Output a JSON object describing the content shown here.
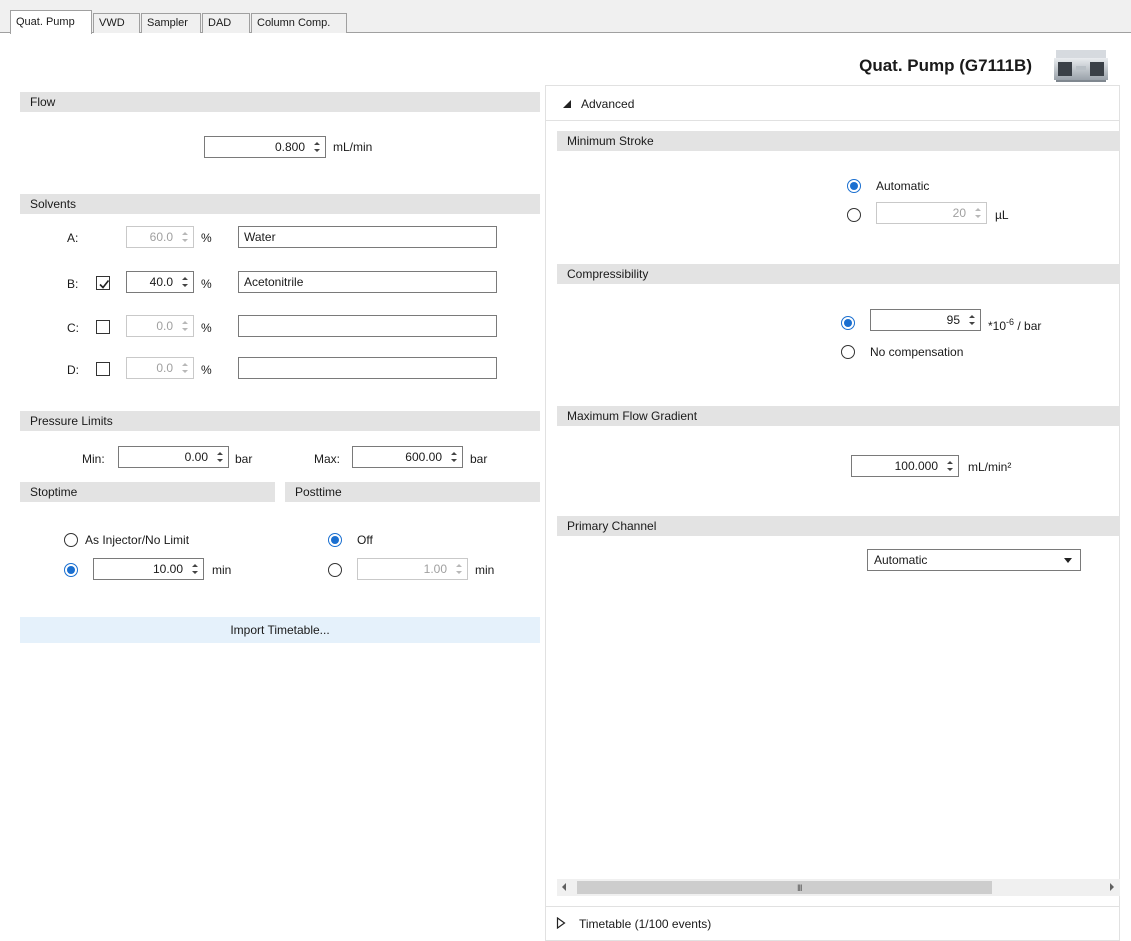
{
  "tabs": [
    {
      "label": "Quat. Pump"
    },
    {
      "label": "VWD"
    },
    {
      "label": "Sampler"
    },
    {
      "label": "DAD"
    },
    {
      "label": "Column Comp."
    }
  ],
  "module_title": "Quat. Pump (G7111B)",
  "flow": {
    "header": "Flow",
    "value": "0.800",
    "unit": "mL/min"
  },
  "solvents": {
    "header": "Solvents",
    "percent_sign": "%",
    "rows": [
      {
        "label": "A:",
        "percent": "60.0",
        "name": "Water",
        "has_checkbox": false
      },
      {
        "label": "B:",
        "percent": "40.0",
        "name": "Acetonitrile",
        "has_checkbox": true,
        "checked": true
      },
      {
        "label": "C:",
        "percent": "0.0",
        "name": "",
        "has_checkbox": true,
        "checked": false
      },
      {
        "label": "D:",
        "percent": "0.0",
        "name": "",
        "has_checkbox": true,
        "checked": false
      }
    ]
  },
  "pressure_limits": {
    "header": "Pressure Limits",
    "min_label": "Min:",
    "min_value": "0.00",
    "max_label": "Max:",
    "max_value": "600.00",
    "unit": "bar"
  },
  "stoptime": {
    "header": "Stoptime",
    "option_no_limit": "As Injector/No Limit",
    "value": "10.00",
    "unit": "min",
    "selected": "value"
  },
  "posttime": {
    "header": "Posttime",
    "option_off": "Off",
    "value": "1.00",
    "unit": "min",
    "selected": "off"
  },
  "import_button": "Import Timetable...",
  "advanced": {
    "label": "Advanced",
    "minimum_stroke": {
      "header": "Minimum Stroke",
      "option_auto": "Automatic",
      "value": "20",
      "unit": "µL",
      "selected": "auto"
    },
    "compressibility": {
      "header": "Compressibility",
      "value": "95",
      "unit_base": "*10",
      "unit_exp": "-6",
      "unit_tail": "/ bar",
      "option_none": "No compensation",
      "selected": "value"
    },
    "max_flow_gradient": {
      "header": "Maximum Flow Gradient",
      "value": "100.000",
      "unit": "mL/min²"
    },
    "primary_channel": {
      "header": "Primary Channel",
      "selected_value": "Automatic"
    }
  },
  "timetable": {
    "label": "Timetable (1/100 events)"
  },
  "scrollbar_grip": "III",
  "colors": {
    "accent": "#1a6fd0",
    "header_bg": "#e3e3e3",
    "button_bg": "#e5f1fb"
  }
}
